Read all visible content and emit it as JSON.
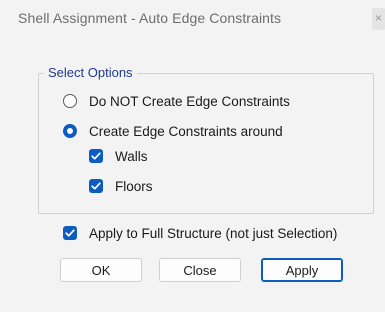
{
  "window": {
    "title": "Shell Assignment - Auto Edge Constraints",
    "close_glyph": "×"
  },
  "select_options": {
    "legend": "Select Options",
    "radio_options": [
      {
        "label": "Do NOT Create Edge Constraints",
        "selected": false
      },
      {
        "label": "Create Edge Constraints around",
        "selected": true
      }
    ],
    "around_checks": [
      {
        "label": "Walls",
        "checked": true
      },
      {
        "label": "Floors",
        "checked": true
      }
    ]
  },
  "apply_full": {
    "label": "Apply to Full Structure (not just Selection)",
    "checked": true
  },
  "buttons": {
    "ok": "OK",
    "close": "Close",
    "apply": "Apply"
  },
  "colors": {
    "accent": "#0f5cc0",
    "legend_text": "#1f3a93",
    "dialog_bg": "#f3f3f3"
  },
  "icons": {
    "checkbox_mark": "check-icon",
    "close": "close-icon"
  }
}
